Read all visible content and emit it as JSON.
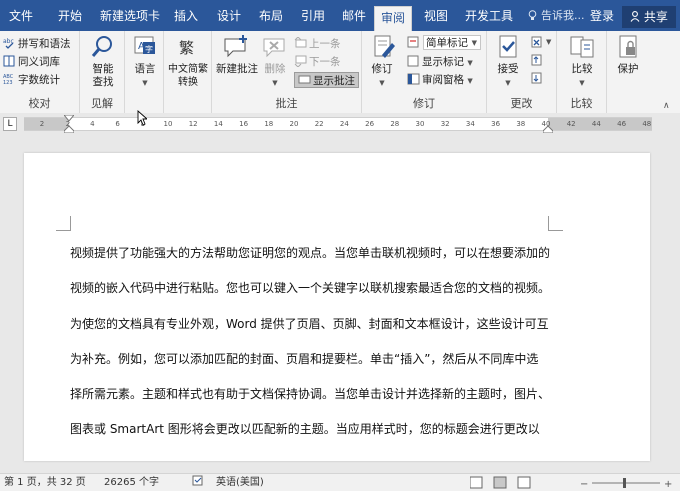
{
  "menubar": {
    "tabs": [
      "文件",
      "开始",
      "新建选项卡",
      "插入",
      "设计",
      "布局",
      "引用",
      "邮件",
      "审阅",
      "视图",
      "开发工具"
    ],
    "active_tab": "审阅",
    "tell_me": "告诉我...",
    "login": "登录",
    "share": "共享"
  },
  "ribbon": {
    "proofing": {
      "spelling": "拼写和语法",
      "thesaurus": "同义词库",
      "word_count": "字数统计",
      "label": "校对"
    },
    "insights": {
      "smart_lookup": "智能查找",
      "label": "见解"
    },
    "language": {
      "language": "语言"
    },
    "chinese_conversion": {
      "convert": "中文简繁转换"
    },
    "comments": {
      "new_comment": "新建批注",
      "delete": "删除",
      "previous": "上一条",
      "next": "下一条",
      "show_comments": "显示批注",
      "label": "批注"
    },
    "tracking": {
      "track_changes": "修订",
      "markup_mode": "简单标记",
      "show_markup": "显示标记",
      "reviewing_pane": "审阅窗格",
      "label": "修订"
    },
    "changes": {
      "accept": "接受",
      "label": "更改"
    },
    "compare": {
      "compare": "比较",
      "label": "比较"
    },
    "protect": {
      "protect": "保护"
    }
  },
  "ruler": {
    "tab_selector": "L",
    "ticks": [
      "2",
      "2",
      "4",
      "6",
      "8",
      "10",
      "12",
      "14",
      "16",
      "18",
      "20",
      "22",
      "24",
      "26",
      "28",
      "30",
      "32",
      "34",
      "36",
      "38",
      "40",
      "42",
      "44",
      "46",
      "48"
    ]
  },
  "document": {
    "lines": [
      "视频提供了功能强大的方法帮助您证明您的观点。当您单击联机视频时，可以在想要添加的",
      "视频的嵌入代码中进行粘贴。您也可以键入一个关键字以联机搜索最适合您的文档的视频。",
      "为使您的文档具有专业外观，Word 提供了页眉、页脚、封面和文本框设计，这些设计可互",
      "为补充。例如，您可以添加匹配的封面、页眉和提要栏。单击“插入”，然后从不同库中选",
      "择所需元素。主题和样式也有助于文档保持协调。当您单击设计并选择新的主题时，图片、",
      "图表或 SmartArt 图形将会更改以匹配新的主题。当应用样式时，您的标题会进行更改以"
    ]
  },
  "status": {
    "page": "第 1 页，共 32 页",
    "words": "26265 个字",
    "language": "英语(美国)"
  },
  "colors": {
    "accent": "#2b579a"
  }
}
